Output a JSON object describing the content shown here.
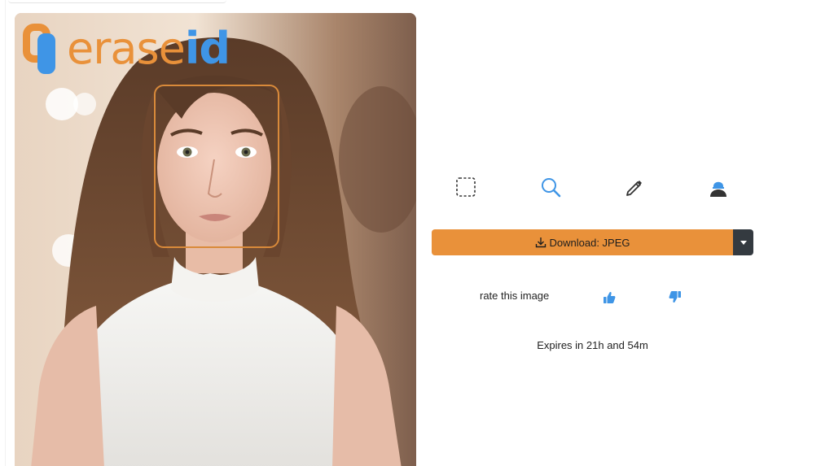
{
  "logo": {
    "word1": "erase",
    "word2": "id"
  },
  "photo": {
    "subject": "portrait-photo"
  },
  "tools": [
    {
      "name": "select-icon"
    },
    {
      "name": "magnifier-icon"
    },
    {
      "name": "pencil-icon"
    },
    {
      "name": "person-icon"
    }
  ],
  "download": {
    "label": "Download: JPEG"
  },
  "rating": {
    "label": "rate this image"
  },
  "expires": {
    "text": "Expires in 21h and 54m"
  },
  "colors": {
    "accent_orange": "#e9913a",
    "accent_blue": "#3f95e6",
    "dark": "#343a40"
  }
}
